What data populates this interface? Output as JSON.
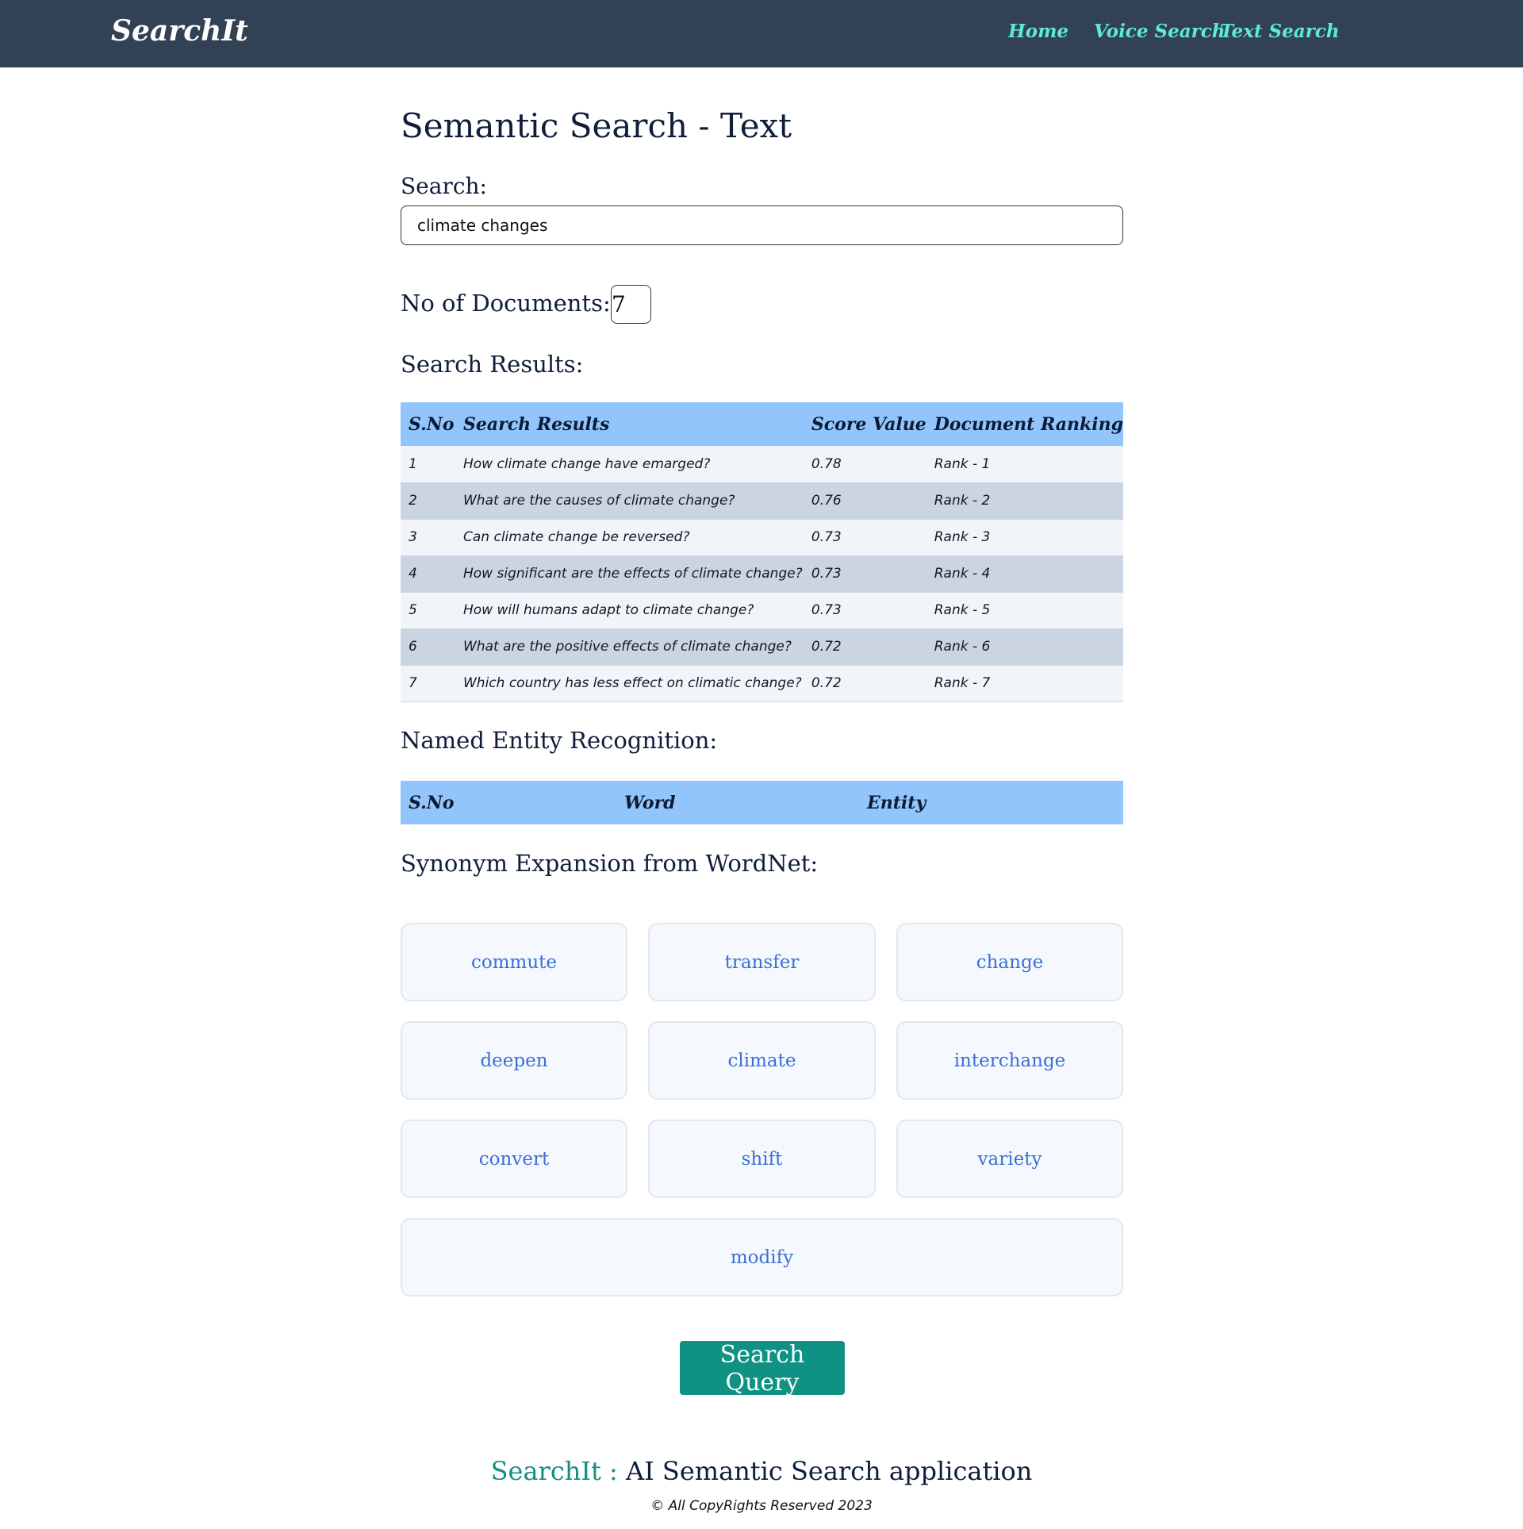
{
  "navbar": {
    "brand": "SearchIt",
    "links": {
      "home": "Home",
      "voice": "Voice Search",
      "text": "Text Search"
    },
    "colors": {
      "background": "#334155",
      "link": "#5eead4"
    }
  },
  "page": {
    "title": "Semantic Search - Text",
    "search_label": "Search:",
    "search_value": "climate changes",
    "docs_label": "No of Documents:",
    "docs_value": "7",
    "results_label": "Search Results:",
    "ner_label": "Named Entity Recognition:",
    "synonym_label": "Synonym Expansion from WordNet:"
  },
  "results_table": {
    "headers": [
      "S.No",
      "Search Results",
      "Score Value",
      "Document Ranking"
    ],
    "rows": [
      [
        "1",
        "How climate change have emarged?",
        "0.78",
        "Rank - 1"
      ],
      [
        "2",
        "What are the causes of climate change?",
        "0.76",
        "Rank - 2"
      ],
      [
        "3",
        "Can climate change be reversed?",
        "0.73",
        "Rank - 3"
      ],
      [
        "4",
        "How significant are the effects of climate change?",
        "0.73",
        "Rank - 4"
      ],
      [
        "5",
        "How will humans adapt to climate change?",
        "0.73",
        "Rank - 5"
      ],
      [
        "6",
        "What are the positive effects of climate change?",
        "0.72",
        "Rank - 6"
      ],
      [
        "7",
        "Which country has less effect on climatic change?",
        "0.72",
        "Rank - 7"
      ]
    ]
  },
  "ner_table": {
    "headers": [
      "S.No",
      "Word",
      "Entity"
    ],
    "rows": []
  },
  "synonyms": [
    "commute",
    "transfer",
    "change",
    "deepen",
    "climate",
    "interchange",
    "convert",
    "shift",
    "variety",
    "modify"
  ],
  "actions": {
    "search_button": "Search Query"
  },
  "footer": {
    "brand": "SearchIt :",
    "tagline": "AI Semantic Search application",
    "copyright": "© All CopyRights Reserved 2023"
  },
  "colors": {
    "table_header": "#93c5fd",
    "row_light": "#f1f5f9",
    "row_dark": "#cbd5e1",
    "synonym_text": "#3b6fd8",
    "button": "#0f9283",
    "footer_brand": "#138f7e"
  }
}
